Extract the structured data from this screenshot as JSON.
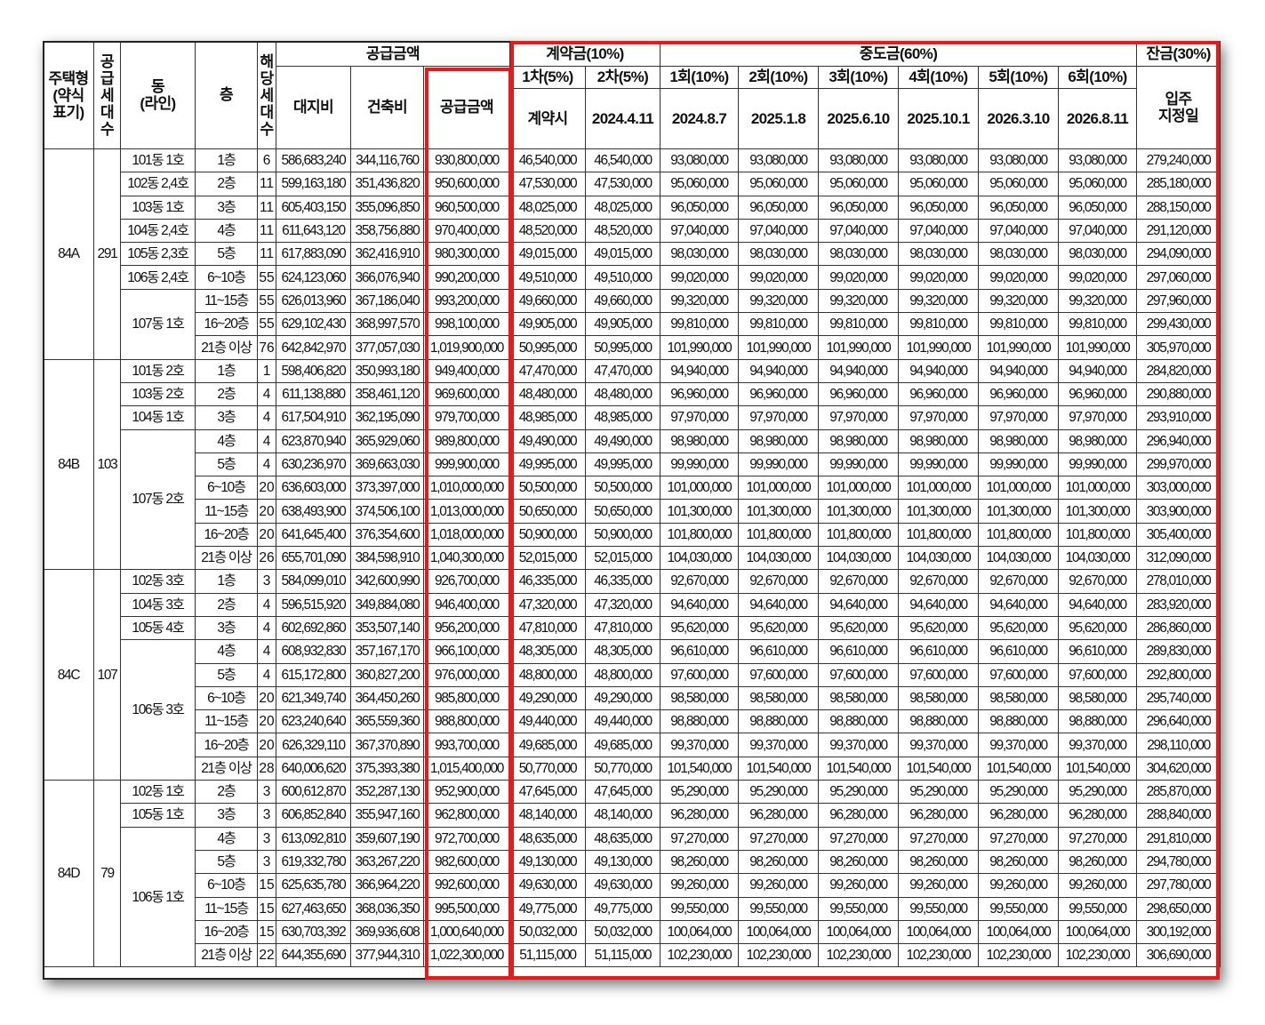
{
  "header": {
    "house_type": "주택형\n(약식\n표기)",
    "units": "공\n급\n세\n대\n수",
    "dong": "동\n(라인)",
    "floor": "층",
    "hh": "해\n당\n세\n대\n수",
    "supply_group": "공급금액",
    "land": "대지비",
    "building": "건축비",
    "supply": "공급금액",
    "contract_group": "계약금(10%)",
    "middle_group": "중도금(60%)",
    "balance_group": "잔금(30%)",
    "c1": "1차(5%)",
    "c2": "2차(5%)",
    "c1_date": "계약시",
    "c2_date": "2024.4.11",
    "m1": "1회(10%)",
    "m2": "2회(10%)",
    "m3": "3회(10%)",
    "m4": "4회(10%)",
    "m5": "5회(10%)",
    "m6": "6회(10%)",
    "m1_date": "2024.8.7",
    "m2_date": "2025.1.8",
    "m3_date": "2025.6.10",
    "m4_date": "2025.10.1",
    "m5_date": "2026.3.10",
    "m6_date": "2026.8.11",
    "balance_date": "입주\n지정일"
  },
  "groups": [
    {
      "type": "84A",
      "units": "291",
      "dongs": [
        {
          "name": "101동 1호",
          "rows": [
            [
              "1층",
              "6",
              "586,683,240",
              "344,116,760",
              "930,800,000",
              "46,540,000",
              "46,540,000",
              "93,080,000",
              "93,080,000",
              "93,080,000",
              "93,080,000",
              "93,080,000",
              "93,080,000",
              "279,240,000"
            ]
          ]
        },
        {
          "name": "102동 2,4호",
          "rows": [
            [
              "2층",
              "11",
              "599,163,180",
              "351,436,820",
              "950,600,000",
              "47,530,000",
              "47,530,000",
              "95,060,000",
              "95,060,000",
              "95,060,000",
              "95,060,000",
              "95,060,000",
              "95,060,000",
              "285,180,000"
            ]
          ]
        },
        {
          "name": "103동 1호",
          "rows": [
            [
              "3층",
              "11",
              "605,403,150",
              "355,096,850",
              "960,500,000",
              "48,025,000",
              "48,025,000",
              "96,050,000",
              "96,050,000",
              "96,050,000",
              "96,050,000",
              "96,050,000",
              "96,050,000",
              "288,150,000"
            ]
          ]
        },
        {
          "name": "104동 2,4호",
          "rows": [
            [
              "4층",
              "11",
              "611,643,120",
              "358,756,880",
              "970,400,000",
              "48,520,000",
              "48,520,000",
              "97,040,000",
              "97,040,000",
              "97,040,000",
              "97,040,000",
              "97,040,000",
              "97,040,000",
              "291,120,000"
            ]
          ]
        },
        {
          "name": "105동 2,3호",
          "rows": [
            [
              "5층",
              "11",
              "617,883,090",
              "362,416,910",
              "980,300,000",
              "49,015,000",
              "49,015,000",
              "98,030,000",
              "98,030,000",
              "98,030,000",
              "98,030,000",
              "98,030,000",
              "98,030,000",
              "294,090,000"
            ]
          ]
        },
        {
          "name": "106동 2,4호",
          "rows": [
            [
              "6~10층",
              "55",
              "624,123,060",
              "366,076,940",
              "990,200,000",
              "49,510,000",
              "49,510,000",
              "99,020,000",
              "99,020,000",
              "99,020,000",
              "99,020,000",
              "99,020,000",
              "99,020,000",
              "297,060,000"
            ]
          ]
        },
        {
          "name": "107동 1호",
          "rows": [
            [
              "11~15층",
              "55",
              "626,013,960",
              "367,186,040",
              "993,200,000",
              "49,660,000",
              "49,660,000",
              "99,320,000",
              "99,320,000",
              "99,320,000",
              "99,320,000",
              "99,320,000",
              "99,320,000",
              "297,960,000"
            ],
            [
              "16~20층",
              "55",
              "629,102,430",
              "368,997,570",
              "998,100,000",
              "49,905,000",
              "49,905,000",
              "99,810,000",
              "99,810,000",
              "99,810,000",
              "99,810,000",
              "99,810,000",
              "99,810,000",
              "299,430,000"
            ],
            [
              "21층 이상",
              "76",
              "642,842,970",
              "377,057,030",
              "1,019,900,000",
              "50,995,000",
              "50,995,000",
              "101,990,000",
              "101,990,000",
              "101,990,000",
              "101,990,000",
              "101,990,000",
              "101,990,000",
              "305,970,000"
            ]
          ]
        }
      ]
    },
    {
      "type": "84B",
      "units": "103",
      "dongs": [
        {
          "name": "101동 2호",
          "rows": [
            [
              "1층",
              "1",
              "598,406,820",
              "350,993,180",
              "949,400,000",
              "47,470,000",
              "47,470,000",
              "94,940,000",
              "94,940,000",
              "94,940,000",
              "94,940,000",
              "94,940,000",
              "94,940,000",
              "284,820,000"
            ]
          ]
        },
        {
          "name": "103동 2호",
          "rows": [
            [
              "2층",
              "4",
              "611,138,880",
              "358,461,120",
              "969,600,000",
              "48,480,000",
              "48,480,000",
              "96,960,000",
              "96,960,000",
              "96,960,000",
              "96,960,000",
              "96,960,000",
              "96,960,000",
              "290,880,000"
            ]
          ]
        },
        {
          "name": "104동 1호",
          "rows": [
            [
              "3층",
              "4",
              "617,504,910",
              "362,195,090",
              "979,700,000",
              "48,985,000",
              "48,985,000",
              "97,970,000",
              "97,970,000",
              "97,970,000",
              "97,970,000",
              "97,970,000",
              "97,970,000",
              "293,910,000"
            ]
          ]
        },
        {
          "name": "107동 2호",
          "rows": [
            [
              "4층",
              "4",
              "623,870,940",
              "365,929,060",
              "989,800,000",
              "49,490,000",
              "49,490,000",
              "98,980,000",
              "98,980,000",
              "98,980,000",
              "98,980,000",
              "98,980,000",
              "98,980,000",
              "296,940,000"
            ],
            [
              "5층",
              "4",
              "630,236,970",
              "369,663,030",
              "999,900,000",
              "49,995,000",
              "49,995,000",
              "99,990,000",
              "99,990,000",
              "99,990,000",
              "99,990,000",
              "99,990,000",
              "99,990,000",
              "299,970,000"
            ],
            [
              "6~10층",
              "20",
              "636,603,000",
              "373,397,000",
              "1,010,000,000",
              "50,500,000",
              "50,500,000",
              "101,000,000",
              "101,000,000",
              "101,000,000",
              "101,000,000",
              "101,000,000",
              "101,000,000",
              "303,000,000"
            ],
            [
              "11~15층",
              "20",
              "638,493,900",
              "374,506,100",
              "1,013,000,000",
              "50,650,000",
              "50,650,000",
              "101,300,000",
              "101,300,000",
              "101,300,000",
              "101,300,000",
              "101,300,000",
              "101,300,000",
              "303,900,000"
            ],
            [
              "16~20층",
              "20",
              "641,645,400",
              "376,354,600",
              "1,018,000,000",
              "50,900,000",
              "50,900,000",
              "101,800,000",
              "101,800,000",
              "101,800,000",
              "101,800,000",
              "101,800,000",
              "101,800,000",
              "305,400,000"
            ],
            [
              "21층 이상",
              "26",
              "655,701,090",
              "384,598,910",
              "1,040,300,000",
              "52,015,000",
              "52,015,000",
              "104,030,000",
              "104,030,000",
              "104,030,000",
              "104,030,000",
              "104,030,000",
              "104,030,000",
              "312,090,000"
            ]
          ]
        }
      ]
    },
    {
      "type": "84C",
      "units": "107",
      "dongs": [
        {
          "name": "102동 3호",
          "rows": [
            [
              "1층",
              "3",
              "584,099,010",
              "342,600,990",
              "926,700,000",
              "46,335,000",
              "46,335,000",
              "92,670,000",
              "92,670,000",
              "92,670,000",
              "92,670,000",
              "92,670,000",
              "92,670,000",
              "278,010,000"
            ]
          ]
        },
        {
          "name": "104동 3호",
          "rows": [
            [
              "2층",
              "4",
              "596,515,920",
              "349,884,080",
              "946,400,000",
              "47,320,000",
              "47,320,000",
              "94,640,000",
              "94,640,000",
              "94,640,000",
              "94,640,000",
              "94,640,000",
              "94,640,000",
              "283,920,000"
            ]
          ]
        },
        {
          "name": "105동 4호",
          "rows": [
            [
              "3층",
              "4",
              "602,692,860",
              "353,507,140",
              "956,200,000",
              "47,810,000",
              "47,810,000",
              "95,620,000",
              "95,620,000",
              "95,620,000",
              "95,620,000",
              "95,620,000",
              "95,620,000",
              "286,860,000"
            ]
          ]
        },
        {
          "name": "106동 3호",
          "rows": [
            [
              "4층",
              "4",
              "608,932,830",
              "357,167,170",
              "966,100,000",
              "48,305,000",
              "48,305,000",
              "96,610,000",
              "96,610,000",
              "96,610,000",
              "96,610,000",
              "96,610,000",
              "96,610,000",
              "289,830,000"
            ],
            [
              "5층",
              "4",
              "615,172,800",
              "360,827,200",
              "976,000,000",
              "48,800,000",
              "48,800,000",
              "97,600,000",
              "97,600,000",
              "97,600,000",
              "97,600,000",
              "97,600,000",
              "97,600,000",
              "292,800,000"
            ],
            [
              "6~10층",
              "20",
              "621,349,740",
              "364,450,260",
              "985,800,000",
              "49,290,000",
              "49,290,000",
              "98,580,000",
              "98,580,000",
              "98,580,000",
              "98,580,000",
              "98,580,000",
              "98,580,000",
              "295,740,000"
            ],
            [
              "11~15층",
              "20",
              "623,240,640",
              "365,559,360",
              "988,800,000",
              "49,440,000",
              "49,440,000",
              "98,880,000",
              "98,880,000",
              "98,880,000",
              "98,880,000",
              "98,880,000",
              "98,880,000",
              "296,640,000"
            ],
            [
              "16~20층",
              "20",
              "626,329,110",
              "367,370,890",
              "993,700,000",
              "49,685,000",
              "49,685,000",
              "99,370,000",
              "99,370,000",
              "99,370,000",
              "99,370,000",
              "99,370,000",
              "99,370,000",
              "298,110,000"
            ],
            [
              "21층 이상",
              "28",
              "640,006,620",
              "375,393,380",
              "1,015,400,000",
              "50,770,000",
              "50,770,000",
              "101,540,000",
              "101,540,000",
              "101,540,000",
              "101,540,000",
              "101,540,000",
              "101,540,000",
              "304,620,000"
            ]
          ]
        }
      ]
    },
    {
      "type": "84D",
      "units": "79",
      "dongs": [
        {
          "name": "102동 1호",
          "rows": [
            [
              "2층",
              "3",
              "600,612,870",
              "352,287,130",
              "952,900,000",
              "47,645,000",
              "47,645,000",
              "95,290,000",
              "95,290,000",
              "95,290,000",
              "95,290,000",
              "95,290,000",
              "95,290,000",
              "285,870,000"
            ]
          ]
        },
        {
          "name": "105동 1호",
          "rows": [
            [
              "3층",
              "3",
              "606,852,840",
              "355,947,160",
              "962,800,000",
              "48,140,000",
              "48,140,000",
              "96,280,000",
              "96,280,000",
              "96,280,000",
              "96,280,000",
              "96,280,000",
              "96,280,000",
              "288,840,000"
            ]
          ]
        },
        {
          "name": "106동 1호",
          "rows": [
            [
              "4층",
              "3",
              "613,092,810",
              "359,607,190",
              "972,700,000",
              "48,635,000",
              "48,635,000",
              "97,270,000",
              "97,270,000",
              "97,270,000",
              "97,270,000",
              "97,270,000",
              "97,270,000",
              "291,810,000"
            ],
            [
              "5층",
              "3",
              "619,332,780",
              "363,267,220",
              "982,600,000",
              "49,130,000",
              "49,130,000",
              "98,260,000",
              "98,260,000",
              "98,260,000",
              "98,260,000",
              "98,260,000",
              "98,260,000",
              "294,780,000"
            ],
            [
              "6~10층",
              "15",
              "625,635,780",
              "366,964,220",
              "992,600,000",
              "49,630,000",
              "49,630,000",
              "99,260,000",
              "99,260,000",
              "99,260,000",
              "99,260,000",
              "99,260,000",
              "99,260,000",
              "297,780,000"
            ],
            [
              "11~15층",
              "15",
              "627,463,650",
              "368,036,350",
              "995,500,000",
              "49,775,000",
              "49,775,000",
              "99,550,000",
              "99,550,000",
              "99,550,000",
              "99,550,000",
              "99,550,000",
              "99,550,000",
              "298,650,000"
            ],
            [
              "16~20층",
              "15",
              "630,703,392",
              "369,936,608",
              "1,000,640,000",
              "50,032,000",
              "50,032,000",
              "100,064,000",
              "100,064,000",
              "100,064,000",
              "100,064,000",
              "100,064,000",
              "100,064,000",
              "300,192,000"
            ],
            [
              "21층 이상",
              "22",
              "644,355,690",
              "377,944,310",
              "1,022,300,000",
              "51,115,000",
              "51,115,000",
              "102,230,000",
              "102,230,000",
              "102,230,000",
              "102,230,000",
              "102,230,000",
              "102,230,000",
              "306,690,000"
            ]
          ]
        }
      ]
    }
  ],
  "highlight_color": "#e31b1b"
}
